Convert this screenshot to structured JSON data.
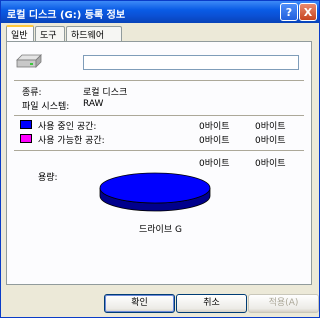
{
  "window": {
    "title": "로컬 디스크 (G:) 등록 정보",
    "help_glyph": "?",
    "close_glyph": "X"
  },
  "tabs": [
    {
      "label": "일반",
      "active": true
    },
    {
      "label": "도구",
      "active": false
    },
    {
      "label": "하드웨어",
      "active": false
    }
  ],
  "general": {
    "volume_name_value": "",
    "type_label": "종류:",
    "type_value": "로컬 디스크",
    "fs_label": "파일 시스템:",
    "fs_value": "RAW",
    "used_label": "사용 중인 공간:",
    "used_bytes": "0바이트",
    "used_size": "0바이트",
    "free_label": "사용 가능한 공간:",
    "free_bytes": "0바이트",
    "free_size": "0바이트",
    "capacity_label": "용량:",
    "capacity_bytes": "0바이트",
    "capacity_size": "0바이트",
    "drive_label": "드라이브 G",
    "used_color": "#0000ff",
    "free_color": "#ff00ff",
    "used_fraction": 1.0
  },
  "buttons": {
    "ok": "확인",
    "cancel": "취소",
    "apply": "적용(A)"
  },
  "icons": {
    "drive": "hard-drive-icon",
    "help": "help-icon",
    "close": "close-icon"
  }
}
